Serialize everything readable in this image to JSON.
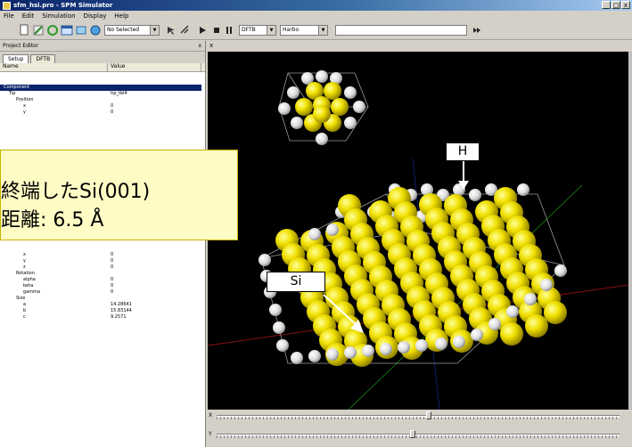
{
  "window": {
    "title": "sfm_hsi.pro - SPM Simulator",
    "controls": [
      "_",
      "□",
      "x"
    ]
  },
  "menu": [
    "File",
    "Edit",
    "Simulation",
    "Display",
    "Help"
  ],
  "toolbar": {
    "selection_combo": "No Selected",
    "mode_combo": "DFTB",
    "method_combo": "Harbo"
  },
  "project_editor": {
    "title": "Project Editor",
    "close": "x",
    "tabs": [
      "Setup",
      "DFTB"
    ],
    "columns": {
      "name": "Name",
      "value": "Value"
    },
    "rows_top": [
      {
        "name": "Component",
        "value": "",
        "indent": 4,
        "selected": true
      },
      {
        "name": "Tip",
        "value": "tip_tbl4",
        "indent": 10
      },
      {
        "name": "Position",
        "value": "",
        "indent": 18
      },
      {
        "name": "x",
        "value": "0",
        "indent": 26
      },
      {
        "name": "y",
        "value": "0",
        "indent": 26
      }
    ],
    "rows_bottom": [
      {
        "name": "x",
        "value": "0",
        "indent": 26
      },
      {
        "name": "y",
        "value": "0",
        "indent": 26
      },
      {
        "name": "z",
        "value": "0",
        "indent": 26
      },
      {
        "name": "Rotation",
        "value": "",
        "indent": 18
      },
      {
        "name": "alpha",
        "value": "0",
        "indent": 26
      },
      {
        "name": "beta",
        "value": "0",
        "indent": 26
      },
      {
        "name": "gamma",
        "value": "0",
        "indent": 26
      },
      {
        "name": "Size",
        "value": "",
        "indent": 18
      },
      {
        "name": "a",
        "value": "14.28641",
        "indent": 26
      },
      {
        "name": "b",
        "value": "15.83144",
        "indent": 26
      },
      {
        "name": "c",
        "value": "9.2571",
        "indent": 26
      }
    ]
  },
  "viewport": {
    "close": "x"
  },
  "sliders": {
    "x": {
      "label": "X",
      "position": 0.52
    },
    "y": {
      "label": "Y",
      "position": 0.48
    }
  },
  "callout": {
    "line1": "終端したSi(001)",
    "line2": "距離: 6.5 Å"
  },
  "labels": {
    "hydrogen": "H",
    "silicon": "Si"
  },
  "colors": {
    "silicon": "#ffee00",
    "hydrogen": "#ffffff",
    "background": "#000000",
    "callout_bg": "#fffbc4"
  }
}
